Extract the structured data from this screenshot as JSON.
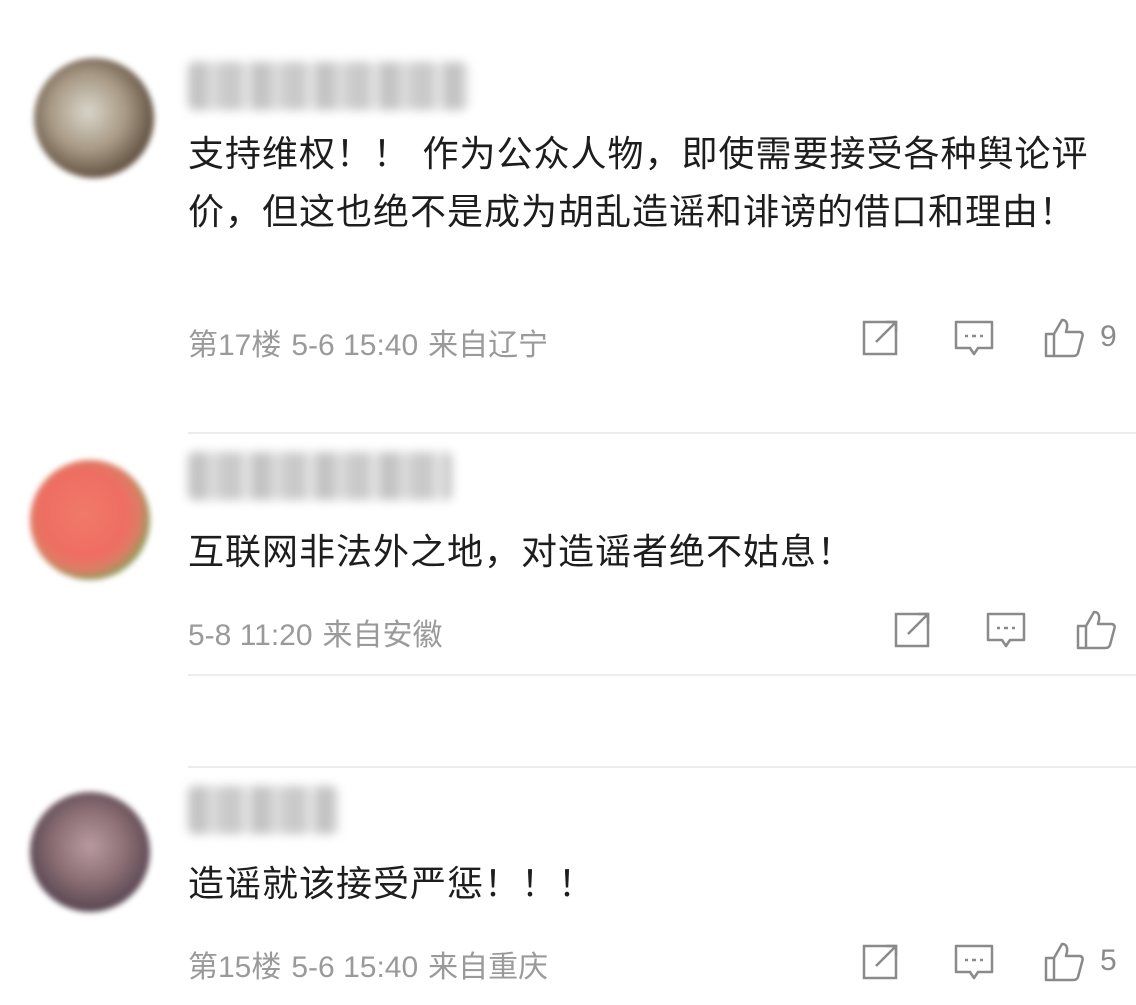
{
  "comments": [
    {
      "text": "支持维权！！ 作为公众人物，即使需要接受各种舆论评价，但这也绝不是成为胡乱造谣和诽谤的借口和理由！",
      "floor": "第17楼",
      "time": "5-6 15:40",
      "location": "来自辽宁",
      "likes": "9",
      "avatar_icon": "user-avatar-icon"
    },
    {
      "text": "互联网非法外之地，对造谣者绝不姑息！",
      "floor": "",
      "time": "5-8 11:20",
      "location": "来自安徽",
      "likes": "",
      "avatar_icon": "user-avatar-icon"
    },
    {
      "text": "造谣就该接受严惩！！！",
      "floor": "第15楼",
      "time": "5-6 15:40",
      "location": "来自重庆",
      "likes": "5",
      "avatar_icon": "user-avatar-icon"
    }
  ],
  "icons": {
    "share": "share-icon",
    "reply": "reply-icon",
    "like": "thumbs-up-icon"
  },
  "colors": {
    "text": "#1d1d1d",
    "meta": "#9a9a9a",
    "icon": "#8a8a8a"
  }
}
